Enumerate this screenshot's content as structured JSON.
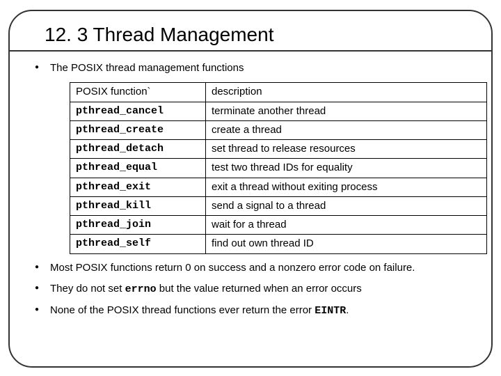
{
  "title": "12. 3 Thread Management",
  "bullets": {
    "intro": "The POSIX thread management functions",
    "b2a": "Most POSIX functions return 0 on success and a nonzero error code on failure.",
    "b3a": "They do not set ",
    "b3code": "errno",
    "b3b": " but the value returned when an error occurs",
    "b4a": "None of the POSIX thread functions ever return the error ",
    "b4code": "EINTR",
    "b4b": "."
  },
  "table": {
    "h1": "POSIX function`",
    "h2": "description",
    "rows": [
      {
        "fn": "pthread_cancel",
        "desc": "terminate another thread"
      },
      {
        "fn": "pthread_create",
        "desc": "create a thread"
      },
      {
        "fn": "pthread_detach",
        "desc": "set thread to release resources"
      },
      {
        "fn": "pthread_equal",
        "desc": "test two thread IDs for equality"
      },
      {
        "fn": "pthread_exit",
        "desc": "exit a thread without exiting process"
      },
      {
        "fn": "pthread_kill",
        "desc": "send a signal to a thread"
      },
      {
        "fn": "pthread_join",
        "desc": "wait for a thread"
      },
      {
        "fn": "pthread_self",
        "desc": "find out own thread ID"
      }
    ]
  }
}
